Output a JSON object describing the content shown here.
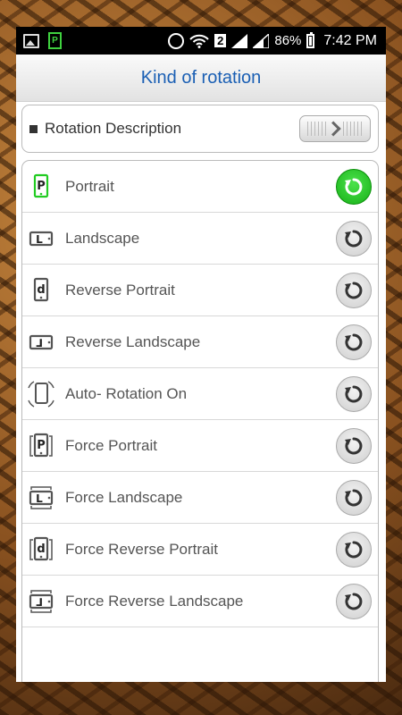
{
  "status_bar": {
    "sim_slot": "2",
    "battery": "86%",
    "time": "7:42 PM"
  },
  "header": {
    "title": "Kind of rotation"
  },
  "description": {
    "label": "Rotation Description"
  },
  "rotations": [
    {
      "label": "Portrait",
      "icon": "portrait-icon",
      "glyph": "P",
      "active": true
    },
    {
      "label": "Landscape",
      "icon": "landscape-icon",
      "glyph": "L",
      "active": false
    },
    {
      "label": "Reverse Portrait",
      "icon": "reverse-portrait-icon",
      "glyph": "d",
      "active": false
    },
    {
      "label": "Reverse Landscape",
      "icon": "reverse-landscape-icon",
      "glyph": "⅃",
      "active": false
    },
    {
      "label": "Auto- Rotation On",
      "icon": "auto-rotation-icon",
      "glyph": "",
      "active": false
    },
    {
      "label": "Force Portrait",
      "icon": "force-portrait-icon",
      "glyph": "P",
      "active": false
    },
    {
      "label": "Force Landscape",
      "icon": "force-landscape-icon",
      "glyph": "L",
      "active": false
    },
    {
      "label": "Force Reverse Portrait",
      "icon": "force-reverse-portrait-icon",
      "glyph": "d",
      "active": false
    },
    {
      "label": "Force Reverse Landscape",
      "icon": "force-reverse-landscape-icon",
      "glyph": "⅃",
      "active": false
    }
  ],
  "colors": {
    "title": "#1a5fb4",
    "active_green": "#17b017",
    "active_icon_border": "#22cc22"
  }
}
